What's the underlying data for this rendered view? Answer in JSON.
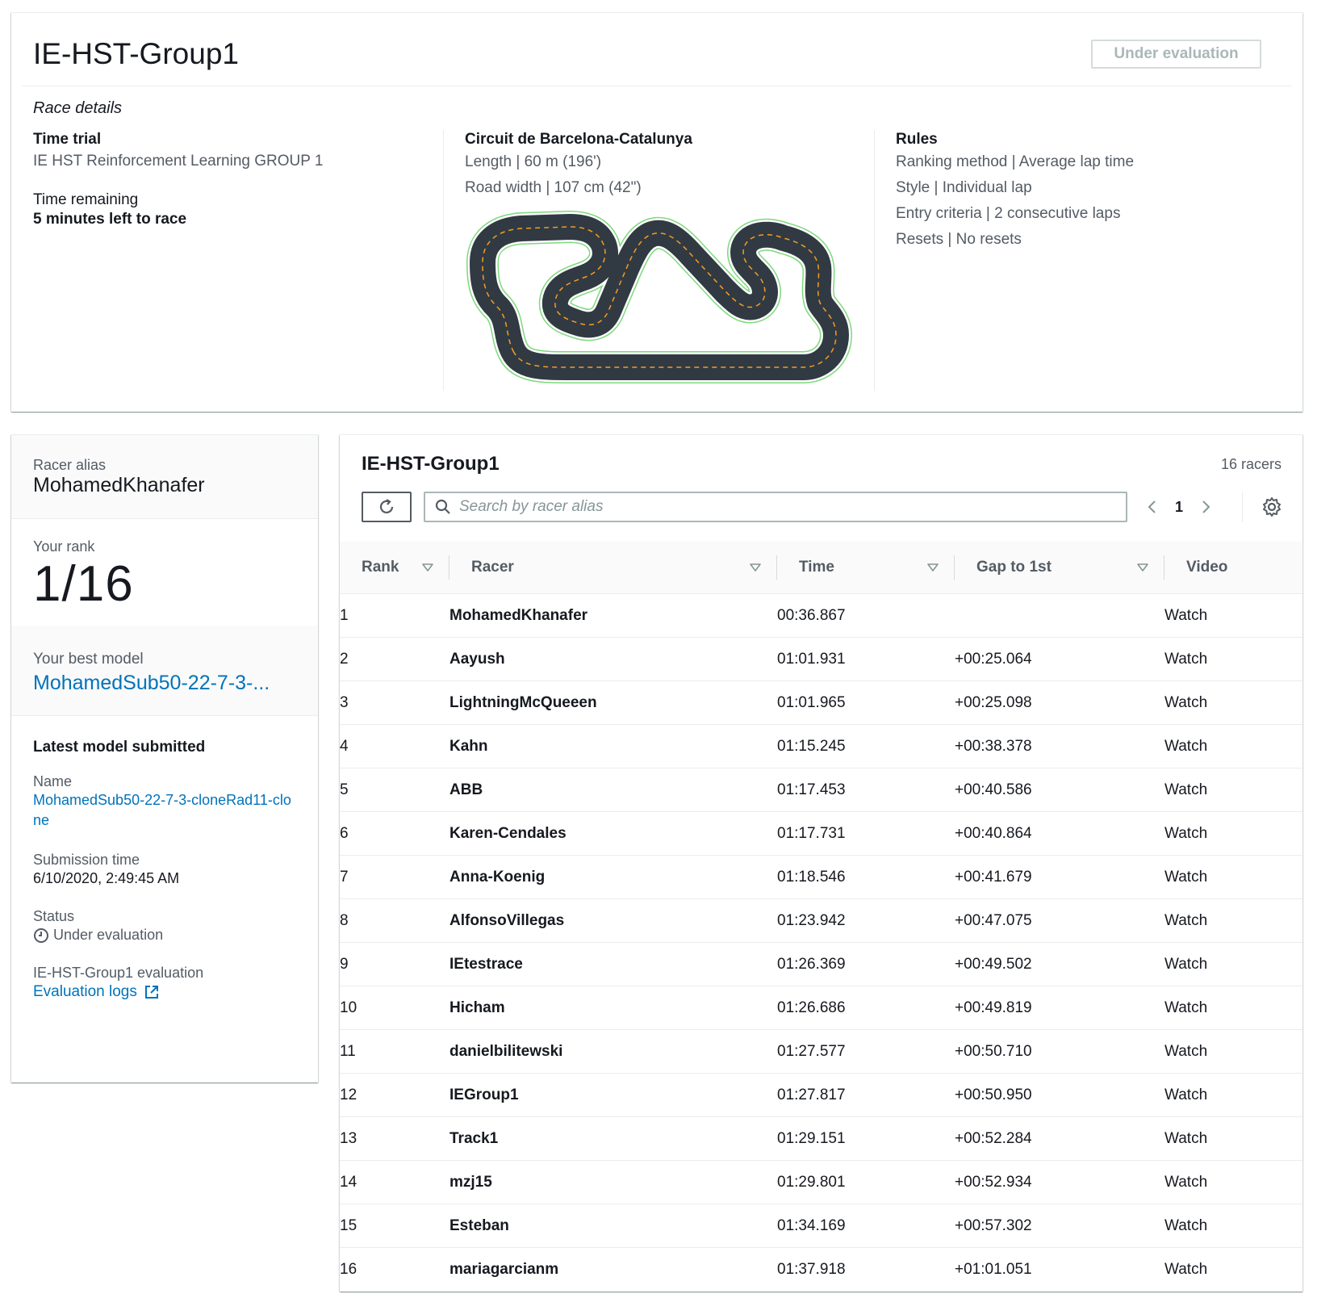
{
  "header": {
    "title": "IE-HST-Group1",
    "status_button": "Under evaluation"
  },
  "race_details": {
    "section_label": "Race details",
    "race_type_heading": "Time trial",
    "race_name": "IE HST Reinforcement Learning GROUP 1",
    "time_remaining_label": "Time remaining",
    "time_remaining_value": "5 minutes left to race",
    "track": {
      "name": "Circuit de Barcelona-Catalunya",
      "length": "Length | 60 m (196')",
      "road_width": "Road width | 107 cm (42\")"
    },
    "rules": {
      "heading": "Rules",
      "items": [
        "Ranking method | Average lap time",
        "Style | Individual lap",
        "Entry criteria | 2 consecutive laps",
        "Resets | No resets"
      ]
    }
  },
  "racer_panel": {
    "alias_label": "Racer alias",
    "alias": "MohamedKhanafer",
    "rank_label": "Your rank",
    "rank": "1/16",
    "best_model_label": "Your best model",
    "best_model": "MohamedSub50-22-7-3-...",
    "latest_heading": "Latest model submitted",
    "name_label": "Name",
    "name_value": "MohamedSub50-22-7-3-cloneRad11-clone",
    "submission_label": "Submission time",
    "submission_value": "6/10/2020, 2:49:45 AM",
    "status_label": "Status",
    "status_value": "Under evaluation",
    "evaluation_label": "IE-HST-Group1 evaluation",
    "evaluation_link": "Evaluation logs"
  },
  "leaderboard": {
    "title": "IE-HST-Group1",
    "racer_count": "16 racers",
    "search_placeholder": "Search by racer alias",
    "current_page": "1",
    "columns": [
      "Rank",
      "Racer",
      "Time",
      "Gap to 1st",
      "Video"
    ],
    "rows": [
      {
        "rank": "1",
        "racer": "MohamedKhanafer",
        "time": "00:36.867",
        "gap": "",
        "video": "Watch"
      },
      {
        "rank": "2",
        "racer": "Aayush",
        "time": "01:01.931",
        "gap": "+00:25.064",
        "video": "Watch"
      },
      {
        "rank": "3",
        "racer": "LightningMcQueeen",
        "time": "01:01.965",
        "gap": "+00:25.098",
        "video": "Watch"
      },
      {
        "rank": "4",
        "racer": "Kahn",
        "time": "01:15.245",
        "gap": "+00:38.378",
        "video": "Watch"
      },
      {
        "rank": "5",
        "racer": "ABB",
        "time": "01:17.453",
        "gap": "+00:40.586",
        "video": "Watch"
      },
      {
        "rank": "6",
        "racer": "Karen-Cendales",
        "time": "01:17.731",
        "gap": "+00:40.864",
        "video": "Watch"
      },
      {
        "rank": "7",
        "racer": "Anna-Koenig",
        "time": "01:18.546",
        "gap": "+00:41.679",
        "video": "Watch"
      },
      {
        "rank": "8",
        "racer": "AlfonsoVillegas",
        "time": "01:23.942",
        "gap": "+00:47.075",
        "video": "Watch"
      },
      {
        "rank": "9",
        "racer": "IEtestrace",
        "time": "01:26.369",
        "gap": "+00:49.502",
        "video": "Watch"
      },
      {
        "rank": "10",
        "racer": "Hicham",
        "time": "01:26.686",
        "gap": "+00:49.819",
        "video": "Watch"
      },
      {
        "rank": "11",
        "racer": "danielbilitewski",
        "time": "01:27.577",
        "gap": "+00:50.710",
        "video": "Watch"
      },
      {
        "rank": "12",
        "racer": "IEGroup1",
        "time": "01:27.817",
        "gap": "+00:50.950",
        "video": "Watch"
      },
      {
        "rank": "13",
        "racer": "Track1",
        "time": "01:29.151",
        "gap": "+00:52.284",
        "video": "Watch"
      },
      {
        "rank": "14",
        "racer": "mzj15",
        "time": "01:29.801",
        "gap": "+00:52.934",
        "video": "Watch"
      },
      {
        "rank": "15",
        "racer": "Esteban",
        "time": "01:34.169",
        "gap": "+00:57.302",
        "video": "Watch"
      },
      {
        "rank": "16",
        "racer": "mariagarcianm",
        "time": "01:37.918",
        "gap": "+01:01.051",
        "video": "Watch"
      }
    ]
  },
  "icons": {
    "refresh": "refresh-icon",
    "search": "search-icon",
    "prev": "chevron-left-icon",
    "next": "chevron-right-icon",
    "settings": "gear-icon",
    "status": "clock-icon",
    "external": "external-link-icon",
    "sort": "caret-down-icon"
  },
  "colors": {
    "link": "#0073bb",
    "track_asphalt": "#313a42",
    "track_centerline": "#f59b24",
    "track_edge": "#7dd87d"
  }
}
